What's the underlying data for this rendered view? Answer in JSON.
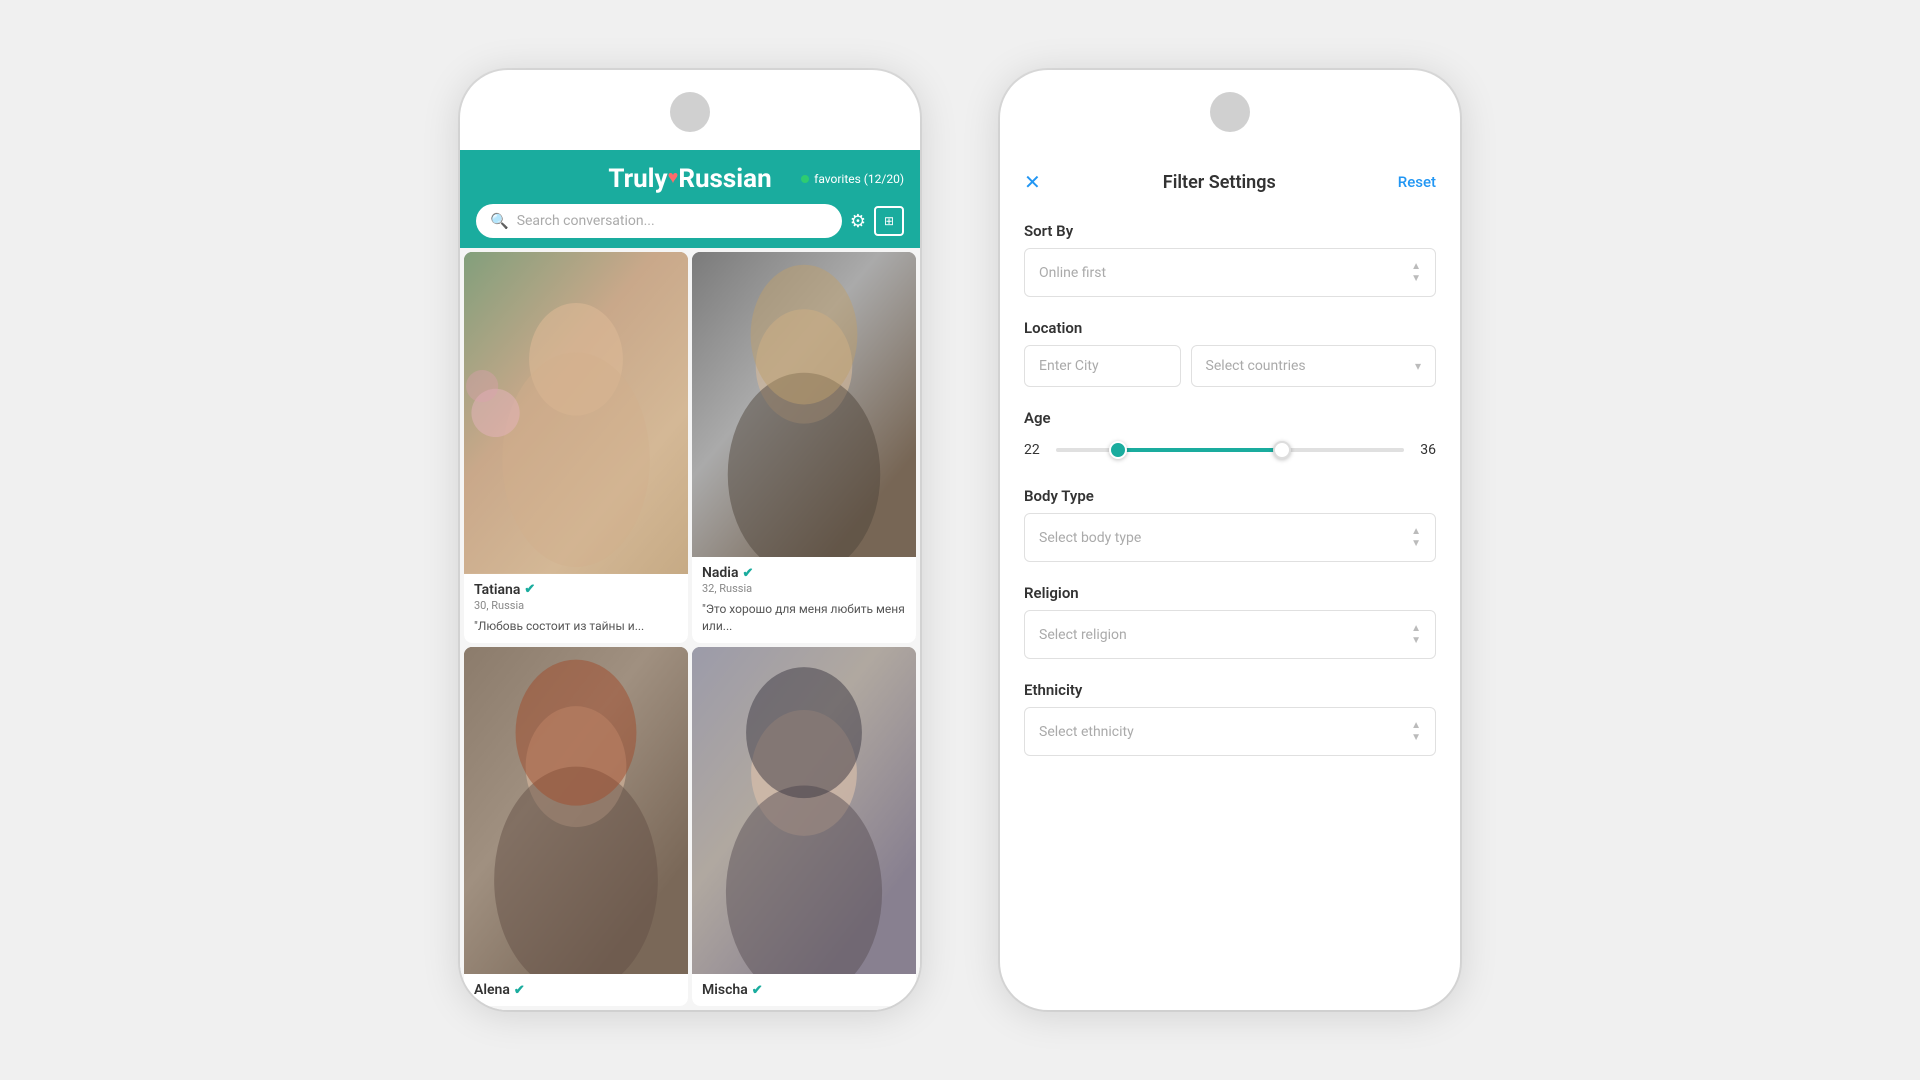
{
  "leftPhone": {
    "header": {
      "logo": {
        "text_truly": "Truly",
        "text_russian": "Russian",
        "heart": "♥"
      },
      "favorites": {
        "label": "favorites (12/20)"
      },
      "search": {
        "placeholder": "Search conversation..."
      }
    },
    "profiles": [
      {
        "id": "tatiana",
        "name": "Tatiana",
        "verified": true,
        "age": "30",
        "location": "Russia",
        "quote": "\"Любовь состоит из тайны и..."
      },
      {
        "id": "nadia",
        "name": "Nadia",
        "verified": true,
        "age": "32",
        "location": "Russia",
        "quote": "\"Это хорошо для меня любить меня или..."
      },
      {
        "id": "alena",
        "name": "Alena",
        "verified": true,
        "age": "",
        "location": "",
        "quote": ""
      },
      {
        "id": "mischa",
        "name": "Mischa",
        "verified": true,
        "age": "",
        "location": "",
        "quote": ""
      }
    ]
  },
  "rightPhone": {
    "header": {
      "title": "Filter Settings",
      "resetLabel": "Reset",
      "closeIcon": "✕"
    },
    "sortBy": {
      "label": "Sort By",
      "placeholder": "Online first"
    },
    "location": {
      "label": "Location",
      "cityPlaceholder": "Enter City",
      "countryPlaceholder": "Select countries"
    },
    "age": {
      "label": "Age",
      "min": 22,
      "max": 36,
      "currentMin": 22,
      "currentMax": 36
    },
    "bodyType": {
      "label": "Body Type",
      "placeholder": "Select body type"
    },
    "religion": {
      "label": "Religion",
      "placeholder": "Select religion"
    },
    "ethnicity": {
      "label": "Ethnicity",
      "placeholder": "Select ethnicity"
    }
  },
  "icons": {
    "search": "🔍",
    "verified": "✔",
    "chevronDown": "▾",
    "arrowUp": "▲",
    "arrowDown": "▼",
    "close": "✕"
  },
  "colors": {
    "teal": "#1aac9e",
    "blue": "#2196F3",
    "green": "#2ecc71"
  }
}
